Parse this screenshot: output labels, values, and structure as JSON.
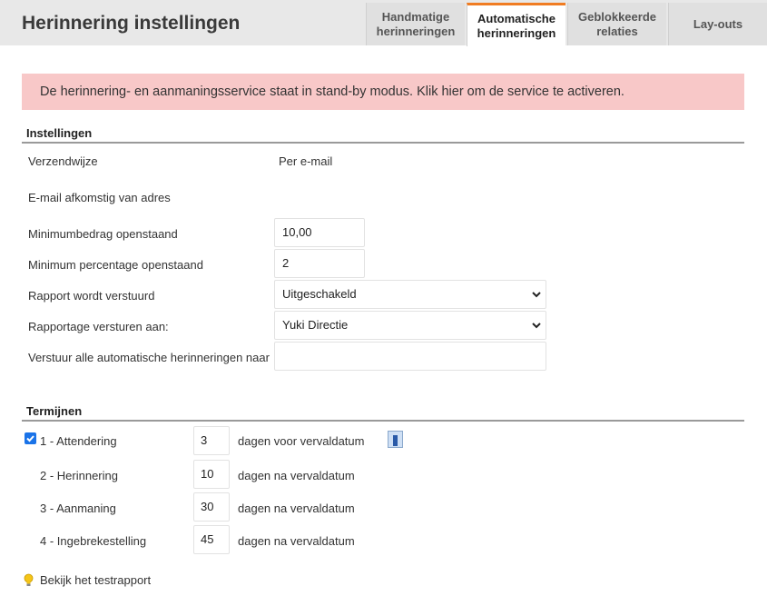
{
  "header": {
    "title": "Herinnering instellingen",
    "tabs": [
      {
        "label": "Handmatige herinneringen"
      },
      {
        "label": "Automatische herinneringen"
      },
      {
        "label": "Geblokkeerde relaties"
      },
      {
        "label": "Lay-outs"
      }
    ],
    "active_tab": "Automatische herinneringen",
    "accent_color": "#f07c22"
  },
  "alert": {
    "text": "De herinnering- en aanmaningsservice staat in stand-by modus. Klik hier om de service te activeren.",
    "background": "#f8c8c8"
  },
  "settings": {
    "section_title": "Instellingen",
    "verzendwijze": {
      "label": "Verzendwijze",
      "value": "Per e-mail"
    },
    "email_from": {
      "label": "E-mail afkomstig van adres",
      "value": ""
    },
    "min_amount": {
      "label": "Minimumbedrag openstaand",
      "value": "10,00"
    },
    "min_percentage": {
      "label": "Minimum percentage openstaand",
      "value": "2"
    },
    "report_sent": {
      "label": "Rapport wordt verstuurd",
      "value": "Uitgeschakeld"
    },
    "report_to": {
      "label": "Rapportage versturen aan:",
      "value": "Yuki Directie"
    },
    "send_all_to": {
      "label": "Verstuur alle automatische herinneringen naar",
      "value": ""
    }
  },
  "terms": {
    "section_title": "Termijnen",
    "items": [
      {
        "label": "1 - Attendering",
        "days": "3",
        "description": "dagen voor vervaldatum",
        "checked": true
      },
      {
        "label": "2 - Herinnering",
        "days": "10",
        "description": "dagen na vervaldatum"
      },
      {
        "label": "3 - Aanmaning",
        "days": "30",
        "description": "dagen na vervaldatum"
      },
      {
        "label": "4 - Ingebrekestelling",
        "days": "45",
        "description": "dagen na vervaldatum"
      }
    ]
  },
  "footer": {
    "test_report_link": "Bekijk het testrapport",
    "icon": "lightbulb-icon"
  }
}
